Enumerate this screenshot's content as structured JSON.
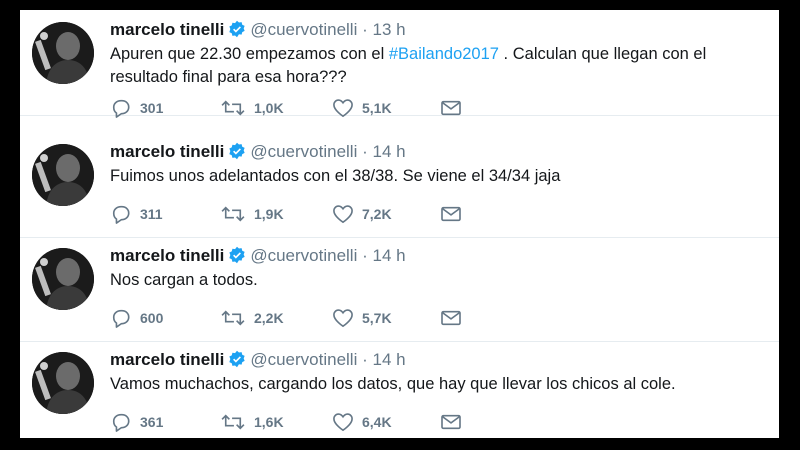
{
  "tweets": [
    {
      "name": "marcelo tinelli",
      "handle": "@cuervotinelli",
      "separator": "·",
      "time": "13 h",
      "text_before": "Apuren que 22.30 empezamos con el ",
      "hashtag": "#Bailando2017",
      "text_after": " . Calculan que llegan con el resultado final para esa hora???",
      "replies": "301",
      "retweets": "1,0K",
      "likes": "5,1K"
    },
    {
      "name": "marcelo tinelli",
      "handle": "@cuervotinelli",
      "separator": "·",
      "time": "14 h",
      "text_before": "Fuimos unos adelantados con el 38/38. Se viene el 34/34 jaja",
      "hashtag": "",
      "text_after": "",
      "replies": "311",
      "retweets": "1,9K",
      "likes": "7,2K"
    },
    {
      "name": "marcelo tinelli",
      "handle": "@cuervotinelli",
      "separator": "·",
      "time": "14 h",
      "text_before": "Nos cargan a todos.",
      "hashtag": "",
      "text_after": "",
      "replies": "600",
      "retweets": "2,2K",
      "likes": "5,7K"
    },
    {
      "name": "marcelo tinelli",
      "handle": "@cuervotinelli",
      "separator": "·",
      "time": "14 h",
      "text_before": "Vamos muchachos, cargando los datos, que hay que llevar los chicos al cole.",
      "hashtag": "",
      "text_after": "",
      "replies": "361",
      "retweets": "1,6K",
      "likes": "6,4K"
    }
  ],
  "icons": {
    "reply": "reply-icon",
    "retweet": "retweet-icon",
    "like": "like-icon",
    "message": "message-icon",
    "verified": "verified-badge-icon"
  },
  "colors": {
    "link": "#1da1f2",
    "muted": "#657786",
    "text": "#14171a",
    "verified": "#1da1f2"
  }
}
